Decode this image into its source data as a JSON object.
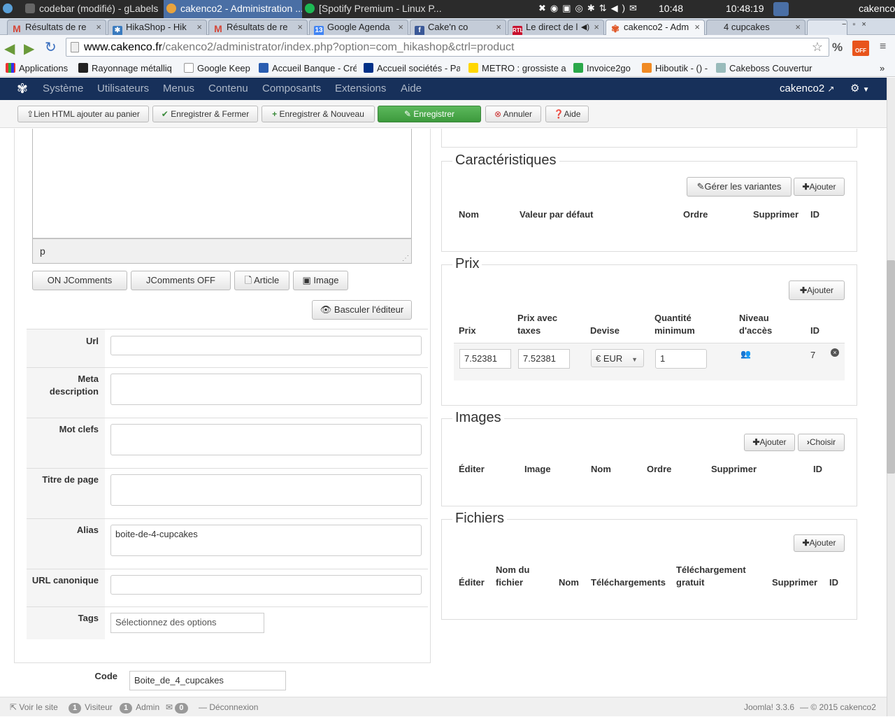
{
  "sysbar": {
    "left_item": "codebar (modifié) - gLabels",
    "active_item": "cakenco2 - Administration ...",
    "spotify_item": "[Spotify Premium - Linux P...",
    "time1": "10:48",
    "time2": "10:48:19",
    "user": "cakenco"
  },
  "tabs": [
    {
      "label": "Résultats de re",
      "icon": "gmail-icon",
      "color": "#d44638"
    },
    {
      "label": "HikaShop - Hik",
      "icon": "hikashop-icon",
      "color": "#3a7bbf"
    },
    {
      "label": "Résultats de re",
      "icon": "gmail-icon",
      "color": "#d44638"
    },
    {
      "label": "Google Agenda",
      "icon": "calendar-icon",
      "color": "#4285f4"
    },
    {
      "label": "Cake'n co",
      "icon": "facebook-icon",
      "color": "#3b5998"
    },
    {
      "label": "Le direct de l",
      "icon": "rtl-icon",
      "color": "#c8102e"
    },
    {
      "label": "cakenco2 - Adm",
      "icon": "joomla-icon",
      "color": "#e05a2b"
    },
    {
      "label": "4 cupcakes",
      "icon": "page-icon",
      "color": "#888"
    }
  ],
  "address": {
    "host": "www.cakenco.fr",
    "path": "/cakenco2/administrator/index.php?option=com_hikashop&ctrl=product"
  },
  "bookmarks": [
    {
      "label": "Applications",
      "color": "#e8a33d"
    },
    {
      "label": "Rayonnage métalliq",
      "color": "#222"
    },
    {
      "label": "Google Keep",
      "color": "#ddd"
    },
    {
      "label": "Accueil Banque - Cré",
      "color": "#2a5db0"
    },
    {
      "label": "Accueil sociétés - Pa",
      "color": "#003087"
    },
    {
      "label": "METRO : grossiste al",
      "color": "#ffd700"
    },
    {
      "label": "Invoice2go",
      "color": "#2ba84a"
    },
    {
      "label": "Hiboutik - () -",
      "color": "#f08a24"
    },
    {
      "label": "Cakeboss Couvertur",
      "color": "#9bb"
    }
  ],
  "joomla_nav": {
    "menus": [
      "Système",
      "Utilisateurs",
      "Menus",
      "Contenu",
      "Composants",
      "Extensions",
      "Aide"
    ],
    "site": "cakenco2"
  },
  "toolbar": {
    "html_link": "Lien HTML ajouter au panier",
    "save_close": "Enregistrer & Fermer",
    "save_new": "Enregistrer & Nouveau",
    "save": "Enregistrer",
    "cancel": "Annuler",
    "help": "Aide"
  },
  "editor": {
    "path_label": "p",
    "buttons": [
      "ON JComments",
      "JComments OFF",
      "Article",
      "Image"
    ],
    "toggle": "Basculer l'éditeur"
  },
  "fields": [
    {
      "label": "Url",
      "value": ""
    },
    {
      "label": "Meta description",
      "value": ""
    },
    {
      "label": "Mot clefs",
      "value": ""
    },
    {
      "label": "Titre de page",
      "value": ""
    },
    {
      "label": "Alias",
      "value": "boite-de-4-cupcakes"
    },
    {
      "label": "URL canonique",
      "value": ""
    },
    {
      "label": "Tags",
      "placeholder": "Sélectionnez des options"
    }
  ],
  "code": {
    "label": "Code",
    "value": "Boite_de_4_cupcakes"
  },
  "caracteristiques": {
    "title": "Caractéristiques",
    "manage_variants": "Gérer les variantes",
    "add": "Ajouter",
    "headers": [
      "Nom",
      "Valeur par défaut",
      "Ordre",
      "Supprimer",
      "ID"
    ]
  },
  "prix": {
    "title": "Prix",
    "add": "Ajouter",
    "headers": {
      "prix": "Prix",
      "prix_taxes_1": "Prix avec",
      "prix_taxes_2": "taxes",
      "devise": "Devise",
      "qty_1": "Quantité",
      "qty_2": "minimum",
      "niveau_1": "Niveau",
      "niveau_2": "d'accès",
      "id": "ID"
    },
    "row": {
      "prix": "7.52381",
      "prix_taxes": "7.52381",
      "devise": "€ EUR",
      "quantite": "1",
      "id": "7"
    }
  },
  "images": {
    "title": "Images",
    "add": "Ajouter",
    "choose": "Choisir",
    "headers": [
      "Éditer",
      "Image",
      "Nom",
      "Ordre",
      "Supprimer",
      "ID"
    ]
  },
  "fichiers": {
    "title": "Fichiers",
    "add": "Ajouter",
    "headers": {
      "editer": "Éditer",
      "nom_fichier_1": "Nom du",
      "nom_fichier_2": "fichier",
      "nom": "Nom",
      "telechargements": "Téléchargements",
      "gratuit_1": "Téléchargement",
      "gratuit_2": "gratuit",
      "supprimer": "Supprimer",
      "id": "ID"
    }
  },
  "status": {
    "view_site": "Voir le site",
    "visitors_count": "1",
    "visitors_label": "Visiteur",
    "admin_count": "1",
    "admin_label": "Admin",
    "messages_count": "0",
    "logout": "Déconnexion",
    "version": "Joomla! 3.3.6",
    "copyright": "— © 2015 cakenco2"
  }
}
